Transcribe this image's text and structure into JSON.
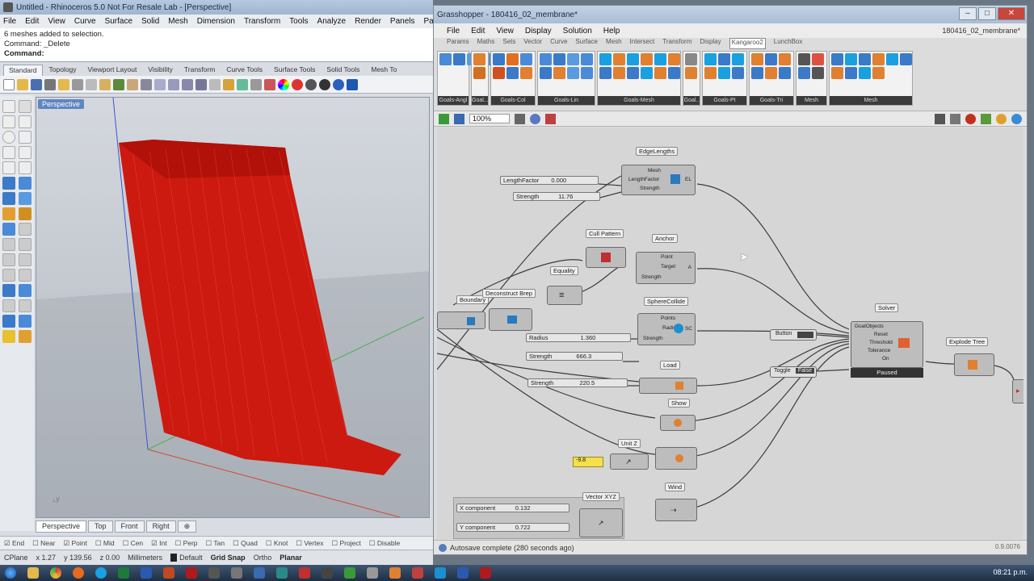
{
  "rhino": {
    "title": "Untitled - Rhinoceros 5.0 Not For Resale Lab - [Perspective]",
    "menu": [
      "File",
      "Edit",
      "View",
      "Curve",
      "Surface",
      "Solid",
      "Mesh",
      "Dimension",
      "Transform",
      "Tools",
      "Analyze",
      "Render",
      "Panels",
      "Paneling"
    ],
    "command_history": [
      "6 meshes added to selection.",
      "Command: _Delete"
    ],
    "command_prompt": "Command:",
    "toolbar_tabs": [
      "Standard",
      "Topology",
      "Viewport Layout",
      "Visibility",
      "Transform",
      "Curve Tools",
      "Surface Tools",
      "Solid Tools",
      "Mesh To"
    ],
    "viewport_label": "Perspective",
    "viewport_tabs": [
      "Perspective",
      "Top",
      "Front",
      "Right"
    ],
    "osnaps": [
      "End",
      "Near",
      "Point",
      "Mid",
      "Cen",
      "Int",
      "Perp",
      "Tan",
      "Quad",
      "Knot",
      "Vertex",
      "Project",
      "Disable"
    ],
    "status": {
      "cplane": "CPlane",
      "x": "x 1.27",
      "y": "y 139.56",
      "z": "z 0.00",
      "units": "Millimeters",
      "layer": "Default",
      "grid_snap": "Grid Snap",
      "ortho": "Ortho",
      "planar": "Planar"
    },
    "mesh_color": "#cc1a10"
  },
  "gh": {
    "title": "Grasshopper - 180416_02_membrane*",
    "doc_title": "180416_02_membrane*",
    "menu": [
      "File",
      "Edit",
      "View",
      "Display",
      "Solution",
      "Help"
    ],
    "subtabs": [
      "Params",
      "Maths",
      "Sets",
      "Vector",
      "Curve",
      "Surface",
      "Mesh",
      "Intersect",
      "Transform",
      "Display",
      "Kangaroo2",
      "LunchBox"
    ],
    "ribbon_groups": [
      "Goals-Angl",
      "Goal...",
      "Goals-Col",
      "Goals-Lin",
      "Goals-Mesh",
      "Goal..",
      "Goals-Pt",
      "Goals-Tri",
      "Mesh",
      "Mesh"
    ],
    "zoom": "100%",
    "status": "Autosave complete (280 seconds ago)",
    "version": "0.9.0076",
    "components": {
      "edge_lengths": {
        "title": "EdgeLengths",
        "inputs": [
          "Mesh",
          "LengthFactor",
          "Strength"
        ],
        "output": "EL"
      },
      "length_factor_slider": {
        "label": "LengthFactor",
        "value": "0.000"
      },
      "strength_slider_1": {
        "label": "Strength",
        "value": "11.76"
      },
      "cull_pattern": {
        "title": "Cull Pattern"
      },
      "anchor": {
        "title": "Anchor",
        "inputs": [
          "Point",
          "Target",
          "Strength"
        ],
        "output": "A"
      },
      "equality": {
        "title": "Equality"
      },
      "boundary": {
        "title": "Boundary"
      },
      "deconstruct": {
        "title": "Deconstruct Brep"
      },
      "sphere_collide": {
        "title": "SphereCollide",
        "inputs": [
          "Points",
          "Radius",
          "Strength"
        ],
        "output": "SC"
      },
      "radius_slider": {
        "label": "Radius",
        "value": "1.360"
      },
      "strength_slider_2": {
        "label": "Strength",
        "value": "666.3"
      },
      "load": {
        "title": "Load"
      },
      "strength_slider_3": {
        "label": "Strength",
        "value": "220.5"
      },
      "show": {
        "title": "Show"
      },
      "unit_z": {
        "title": "Unit Z"
      },
      "panel": {
        "value": "-9.8"
      },
      "wind": {
        "title": "Wind"
      },
      "vector_xyz": {
        "title": "Vector XYZ"
      },
      "x_slider": {
        "label": "X component",
        "value": "0.132"
      },
      "y_slider": {
        "label": "Y component",
        "value": "0.722"
      },
      "solver": {
        "title": "Solver",
        "inputs": [
          "GoalObjects",
          "Reset",
          "Threshold",
          "Tolerance",
          "On"
        ],
        "output": "Paused"
      },
      "button": {
        "label": "Button"
      },
      "toggle": {
        "label": "Toggle",
        "value": "False"
      },
      "explode_tree": {
        "title": "Explode Tree"
      }
    }
  },
  "taskbar": {
    "clock": "08:21 p.m."
  }
}
